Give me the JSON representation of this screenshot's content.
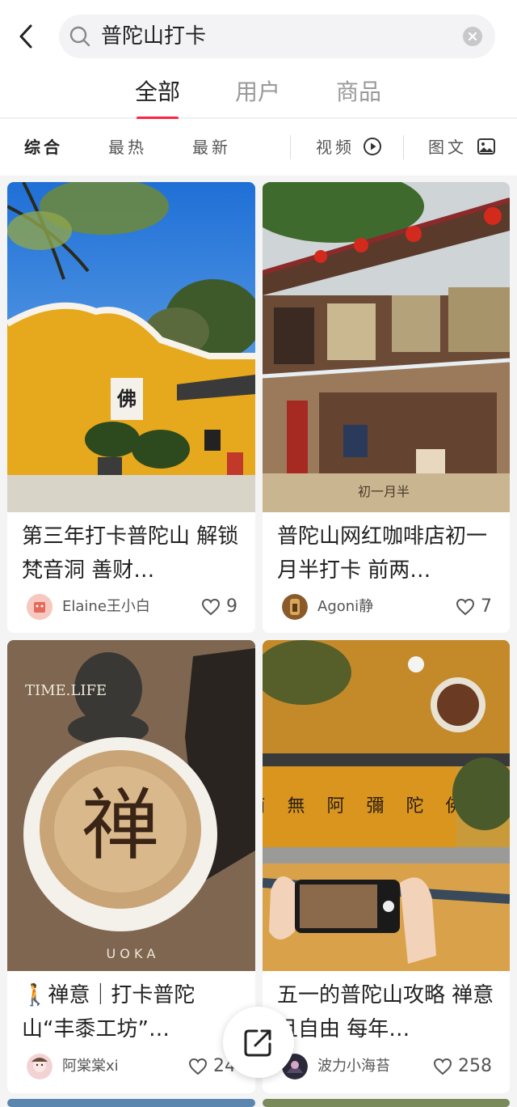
{
  "search": {
    "query": "普陀山打卡"
  },
  "tabs": [
    {
      "label": "全部",
      "active": true
    },
    {
      "label": "用户",
      "active": false
    },
    {
      "label": "商品",
      "active": false
    }
  ],
  "filters": {
    "sort": [
      "综合",
      "最热",
      "最新"
    ],
    "video_label": "视频",
    "image_label": "图文"
  },
  "colors": {
    "accent": "#ff2442"
  },
  "cards": [
    {
      "title": "第三年打卡普陀山 解锁梵音洞 善财…",
      "author": "Elaine王小白",
      "likes": "9",
      "cover_text": "佛"
    },
    {
      "title": "普陀山网红咖啡店初一月半打卡 前两…",
      "author": "Agoni静",
      "likes": "7",
      "cover_text": "初一月半"
    },
    {
      "title": "🚶禅意｜打卡普陀山“丰黍工坊”…",
      "author": "阿棠棠xi",
      "likes": "24",
      "cover_text_1": "TIME.LIFE",
      "cover_text_2": "禅",
      "cover_text_3": "U O K A"
    },
    {
      "title": "五一的普陀山攻略 禅意且自由 每年…",
      "author": "波力小海苔",
      "likes": "258",
      "cover_text": "南 無 阿 彌 陀 佛"
    }
  ]
}
